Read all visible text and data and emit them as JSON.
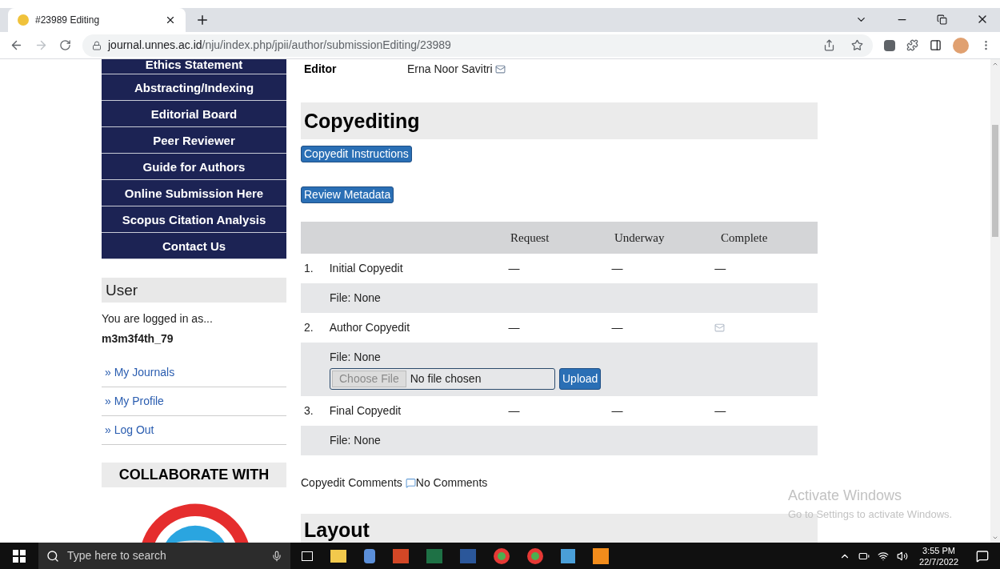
{
  "browser": {
    "tabs": [
      {
        "title": "#23989 Editing",
        "selected": true
      }
    ],
    "url_host": "journal.unnes.ac.id",
    "url_path": "/nju/index.php/jpii/author/submissionEditing/23989"
  },
  "sidebar": {
    "nav_items": [
      "Ethics Statement",
      "Abstracting/Indexing",
      "Editorial Board",
      "Peer Reviewer",
      "Guide for Authors",
      "Online Submission Here",
      "Scopus Citation Analysis",
      "Contact Us"
    ],
    "user": {
      "title": "User",
      "logged_in_text": "You are logged in as...",
      "username": "m3m3f4th_79",
      "links": [
        "» My Journals",
        "» My Profile",
        "» Log Out"
      ]
    },
    "collaborate_title": "COLLABORATE WITH"
  },
  "main": {
    "editor_label": "Editor",
    "editor_name": "Erna Noor Savitri",
    "section_title": "Copyediting",
    "buttons": [
      "Copyedit Instructions",
      "Review Metadata"
    ],
    "table": {
      "columns": [
        "Request",
        "Underway",
        "Complete"
      ],
      "rows": [
        {
          "number": "1.",
          "name": "Initial Copyedit",
          "cells": [
            {
              "kind": "dash",
              "text": "—"
            },
            {
              "kind": "dash",
              "text": "—"
            },
            {
              "kind": "dash",
              "text": "—"
            }
          ],
          "file": "File: None",
          "upload": false
        },
        {
          "number": "2.",
          "name": "Author Copyedit",
          "cells": [
            {
              "kind": "dash",
              "text": "—"
            },
            {
              "kind": "dash",
              "text": "—"
            },
            {
              "kind": "mail"
            }
          ],
          "file": "File: None",
          "upload": true,
          "choose_file": "Choose File",
          "no_file": "No file chosen",
          "upload_label": "Upload"
        },
        {
          "number": "3.",
          "name": "Final Copyedit",
          "cells": [
            {
              "kind": "dash",
              "text": "—"
            },
            {
              "kind": "dash",
              "text": "—"
            },
            {
              "kind": "dash",
              "text": "—"
            }
          ],
          "file": "File: None",
          "upload": false
        }
      ]
    },
    "comments_label": "Copyedit Comments",
    "comments_value": "No Comments",
    "next_section_title": "Layout"
  },
  "activation": {
    "title": "Activate Windows",
    "subtitle": "Go to Settings to activate Windows."
  },
  "taskbar": {
    "search_placeholder": "Type here to search",
    "time": "3:55 PM",
    "date": "22/7/2022"
  }
}
